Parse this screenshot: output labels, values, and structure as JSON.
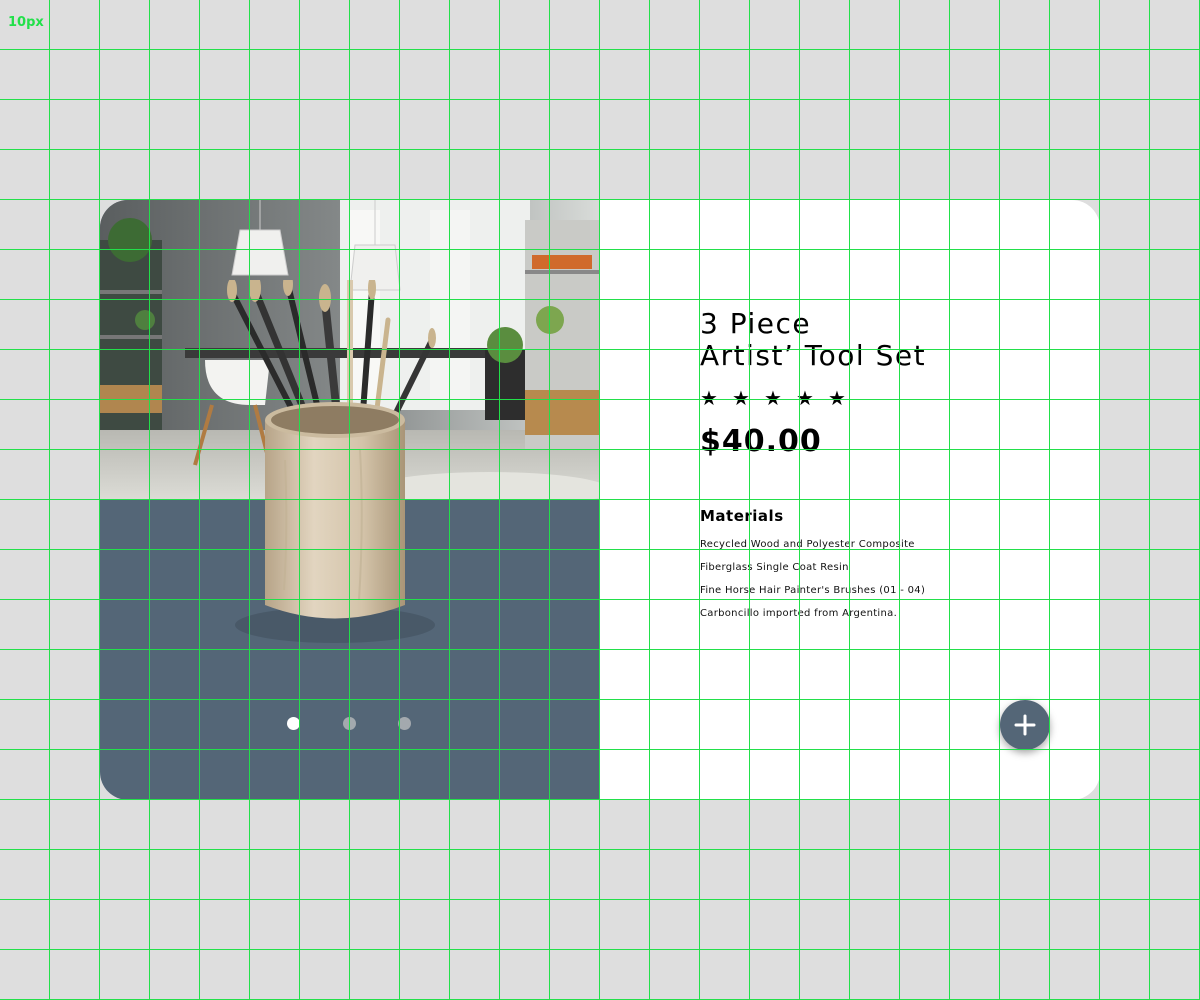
{
  "grid": {
    "label": "10px"
  },
  "product": {
    "title_line1": "3 Piece",
    "title_line2": "Artist’ Tool Set",
    "rating": {
      "value": 5,
      "max": 5,
      "star_glyph": "★"
    },
    "price": "$40.00",
    "materials": {
      "heading": "Materials",
      "items": [
        "Recycled Wood and Polyester Composite",
        "Fiberglass Single Coat Resin",
        "Fine Horse Hair Painter's Brushes (01 - 04)",
        "Carboncillo imported from Argentina."
      ]
    }
  },
  "carousel": {
    "slides": 3,
    "active_index": 0
  },
  "actions": {
    "add_icon": "plus-icon"
  },
  "colors": {
    "page_background": "#dedede",
    "card_background": "#ffffff",
    "accent_slate": "#546677",
    "dot_inactive": "#a3a9ae",
    "dot_active": "#ffffff",
    "grid_line": "#22e04a"
  }
}
